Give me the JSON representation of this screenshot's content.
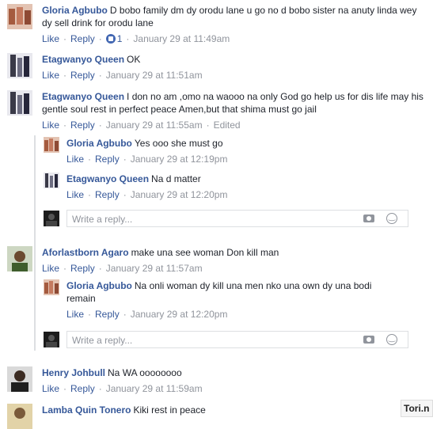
{
  "actions": {
    "like": "Like",
    "reply": "Reply",
    "edited": "Edited",
    "sep": "·"
  },
  "reply_placeholder": "Write a reply...",
  "comments": [
    {
      "name": "Gloria Agbubo",
      "text": "D bobo family dm dy orodu lane u go no d bobo sister na anuty linda wey dy sell drink for orodu lane",
      "reactions": "1",
      "date": "January 29 at 11:49am",
      "avatar": "gloria"
    },
    {
      "name": "Etagwanyo Queen",
      "text": "OK",
      "date": "January 29 at 11:51am",
      "avatar": "etagwanyo"
    },
    {
      "name": "Etagwanyo Queen",
      "text": "I don no am ,omo na waooo na only God go help us for dis life may his gentle soul rest in perfect peace Amen,but that shima must go jail",
      "date": "January 29 at 11:55am",
      "avatar": "etagwanyo",
      "replies": [
        {
          "name": "Gloria Agbubo",
          "text": "Yes ooo she must go",
          "date": "January 29 at 12:19pm",
          "avatar": "gloria"
        },
        {
          "name": "Etagwanyo Queen",
          "text": "Na d matter",
          "date": "January 29 at 12:20pm",
          "avatar": "etagwanyo"
        }
      ]
    },
    {
      "name": "Aforlastborn Agaro",
      "text": "make una see woman Don kill man",
      "date": "January 29 at 11:57am",
      "avatar": "aforlastborn",
      "replies": [
        {
          "name": "Gloria Agbubo",
          "text": "Na onli woman dy kill una men nko una own dy una bodi remain",
          "date": "January 29 at 12:20pm",
          "avatar": "gloria"
        }
      ]
    },
    {
      "name": "Henry Johbull",
      "text": "Na WA oooooooo",
      "date": "January 29 at 11:59am",
      "avatar": "henry"
    },
    {
      "name": "Lamba Quin Tonero",
      "text": "Kiki rest in peace",
      "avatar": "lamba"
    }
  ],
  "watermark": "Tori.n"
}
